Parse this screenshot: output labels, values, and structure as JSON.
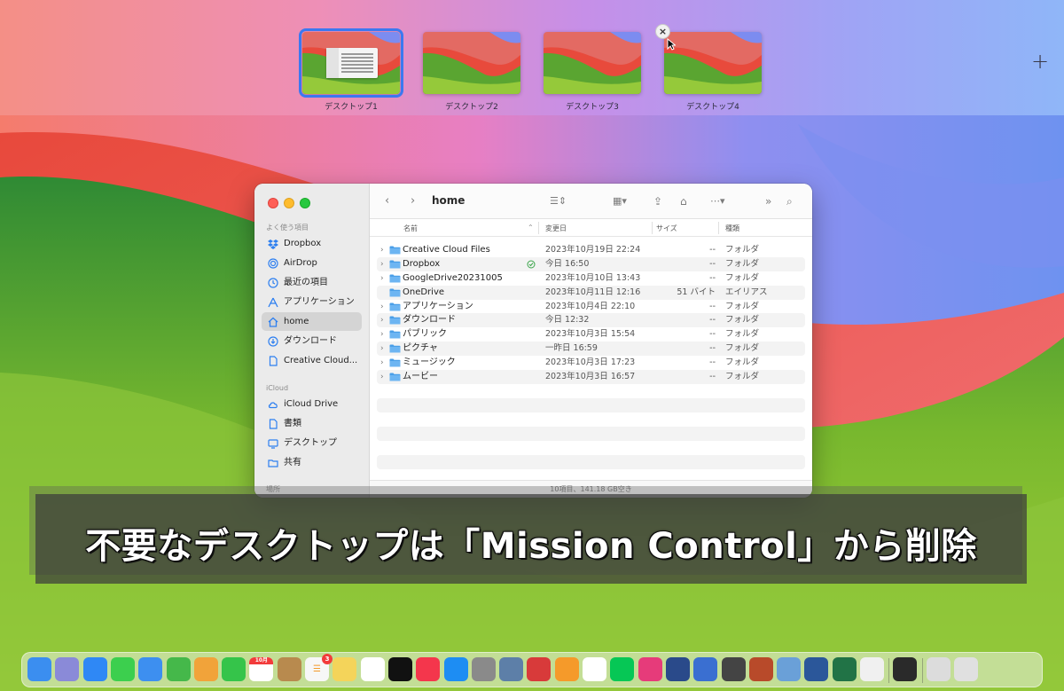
{
  "mission_control": {
    "spaces": [
      {
        "label": "デスクトップ1",
        "active": true
      },
      {
        "label": "デスクトップ2",
        "active": false
      },
      {
        "label": "デスクトップ3",
        "active": false
      },
      {
        "label": "デスクトップ4",
        "active": false
      }
    ],
    "close_glyph": "×",
    "add_glyph": "+"
  },
  "finder": {
    "title": "home",
    "sidebar": {
      "favorites_header": "よく使う項目",
      "favorites": [
        {
          "label": "Dropbox",
          "icon": "dropbox-icon"
        },
        {
          "label": "AirDrop",
          "icon": "airdrop-icon"
        },
        {
          "label": "最近の項目",
          "icon": "clock-icon"
        },
        {
          "label": "アプリケーション",
          "icon": "applications-icon"
        },
        {
          "label": "home",
          "icon": "home-icon",
          "selected": true
        },
        {
          "label": "ダウンロード",
          "icon": "download-icon"
        },
        {
          "label": "Creative Cloud...",
          "icon": "document-icon"
        }
      ],
      "icloud_header": "iCloud",
      "icloud": [
        {
          "label": "iCloud Drive",
          "icon": "cloud-icon"
        },
        {
          "label": "書類",
          "icon": "document-icon"
        },
        {
          "label": "デスクトップ",
          "icon": "desktop-icon"
        },
        {
          "label": "共有",
          "icon": "shared-folder-icon"
        }
      ],
      "locations_header": "場所"
    },
    "columns": {
      "name": "名前",
      "modified": "変更日",
      "size": "サイズ",
      "kind": "種類"
    },
    "files": [
      {
        "name": "Creative Cloud Files",
        "date": "2023年10月19日 22:24",
        "size": "--",
        "kind": "フォルダ",
        "expandable": true
      },
      {
        "name": "Dropbox",
        "date": "今日 16:50",
        "size": "--",
        "kind": "フォルダ",
        "expandable": true,
        "synced": true
      },
      {
        "name": "GoogleDrive20231005",
        "date": "2023年10月10日 13:43",
        "size": "--",
        "kind": "フォルダ",
        "expandable": true
      },
      {
        "name": "OneDrive",
        "date": "2023年10月11日 12:16",
        "size": "51 バイト",
        "kind": "エイリアス",
        "expandable": false
      },
      {
        "name": "アプリケーション",
        "date": "2023年10月4日 22:10",
        "size": "--",
        "kind": "フォルダ",
        "expandable": true
      },
      {
        "name": "ダウンロード",
        "date": "今日 12:32",
        "size": "--",
        "kind": "フォルダ",
        "expandable": true
      },
      {
        "name": "パブリック",
        "date": "2023年10月3日 15:54",
        "size": "--",
        "kind": "フォルダ",
        "expandable": true
      },
      {
        "name": "ピクチャ",
        "date": "一昨日 16:59",
        "size": "--",
        "kind": "フォルダ",
        "expandable": true
      },
      {
        "name": "ミュージック",
        "date": "2023年10月3日 17:23",
        "size": "--",
        "kind": "フォルダ",
        "expandable": true
      },
      {
        "name": "ムービー",
        "date": "2023年10月3日 16:57",
        "size": "--",
        "kind": "フォルダ",
        "expandable": true
      }
    ],
    "status": "10項目、141.18 GB空き"
  },
  "caption": "不要なデスクトップは「Mission Control」から削除",
  "dock": {
    "calendar_day": "23",
    "calendar_month": "10月",
    "reminders_badge": "3",
    "icons": [
      "finder-icon",
      "launchpad-icon",
      "safari-icon",
      "messages-icon",
      "mail-icon",
      "maps-icon",
      "photos-icon",
      "facetime-icon",
      "calendar-icon",
      "contacts-icon",
      "reminders-icon",
      "notes-icon",
      "freeform-icon",
      "apple-tv-icon",
      "music-icon",
      "app-store-icon",
      "system-settings-icon",
      "preview-icon",
      "photo-booth-icon",
      "pages-icon",
      "chrome-icon",
      "line-icon",
      "affinity-icon",
      "app-icon",
      "app-icon",
      "terminal-icon",
      "app-icon",
      "preview-icon",
      "word-icon",
      "excel-icon",
      "textedit-icon",
      "quicktime-icon",
      "downloads-stack-icon",
      "trash-icon"
    ]
  },
  "colors": {
    "accent": "#3b78f0",
    "folder": "#4a9fe8"
  }
}
